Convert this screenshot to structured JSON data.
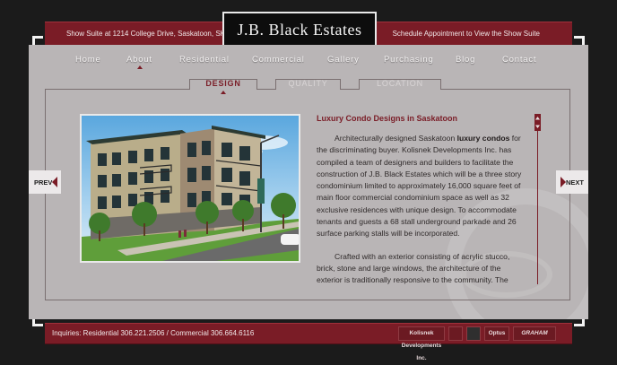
{
  "header": {
    "left_text": "Show Suite at 1214 College Drive, Saskatoon, SK",
    "right_text": "Schedule Appointment to View the Show Suite",
    "logo_text": "J.B. Black Estates"
  },
  "nav": {
    "items": [
      {
        "label": "Home"
      },
      {
        "label": "About"
      },
      {
        "label": "Residential"
      },
      {
        "label": "Commercial"
      },
      {
        "label": "Gallery"
      },
      {
        "label": "Purchasing"
      },
      {
        "label": "Blog"
      },
      {
        "label": "Contact"
      }
    ],
    "active": "About"
  },
  "subtabs": {
    "items": [
      {
        "label": "DESIGN"
      },
      {
        "label": "QUALITY"
      },
      {
        "label": "LOCATION"
      }
    ],
    "active": "DESIGN"
  },
  "content": {
    "title": "Luxury Condo Designs in Saskatoon",
    "p1_pre": "Architecturally designed Saskatoon ",
    "p1_bold": "luxury condos",
    "p1_post": " for the discriminating buyer. Kolisnek Developments Inc. has compiled a team of designers and builders to facilitate the construction of J.B. Black Estates which will be a three story condominium limited to approximately 16,000 square feet of main floor commercial condominium space as well as 32 exclusive residences with unique design. To accommodate tenants and guests a 68 stall underground parkade and 26 surface parking stalls will be incorporated.",
    "p2": "Crafted with an exterior consisting of acrylic stucco, brick, stone and large windows, the architecture of the exterior is traditionally responsive to the community. The"
  },
  "pager": {
    "prev_label": "PREV",
    "next_label": "NEXT"
  },
  "footer": {
    "inquiries": "Inquiries: Residential 306.221.2506  /  Commercial 306.664.6116",
    "partners": [
      "Kolisnek Developments Inc.",
      "",
      "Optus",
      "GRAHAM"
    ]
  },
  "colors": {
    "accent": "#7a1c26",
    "panel": "#b9b5b6",
    "background": "#1b1b1b"
  }
}
